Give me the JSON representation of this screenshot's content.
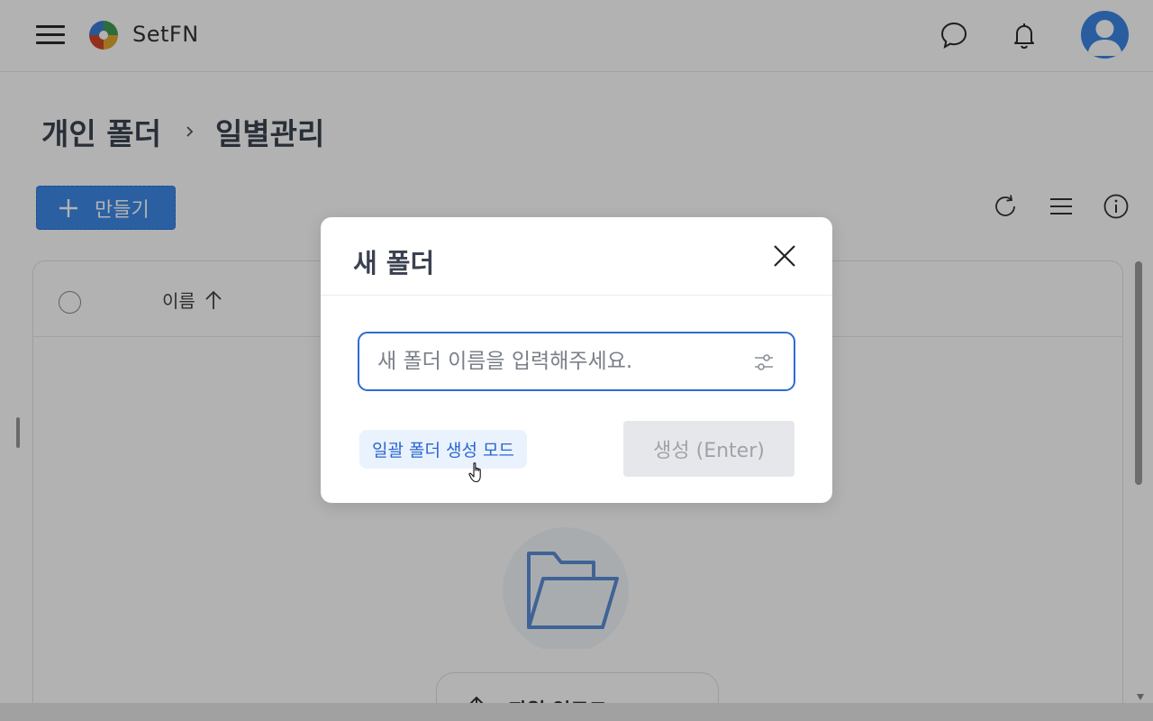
{
  "app": {
    "brand": "SetFN"
  },
  "breadcrumb": {
    "items": [
      "개인 폴더",
      "일별관리"
    ]
  },
  "toolbar": {
    "create_label": "만들기"
  },
  "table": {
    "name_column": "이름"
  },
  "upload": {
    "label": "파일 업로드"
  },
  "modal": {
    "title": "새 폴더",
    "input_placeholder": "새 폴더 이름을 입력해주세요.",
    "input_value": "",
    "bulk_mode_label": "일괄 폴더 생성 모드",
    "submit_label": "생성 (Enter)"
  },
  "icons": {
    "menu": "hamburger-icon",
    "logo": "setfn-logo-icon",
    "chat": "chat-bubble-icon",
    "notifications": "bell-icon",
    "user": "user-avatar-icon",
    "refresh": "refresh-icon",
    "list_view": "list-view-icon",
    "info": "info-icon",
    "sort": "arrow-up-icon",
    "close": "close-icon",
    "options": "sliders-icon",
    "folder": "open-folder-icon",
    "upload": "upload-arrow-icon"
  },
  "colors": {
    "accent": "#2f6ad6",
    "create_button": "#3d8ae8",
    "bulk_mode_bg": "#eaf2fd",
    "disabled_button": "#e6e7ea",
    "overlay": "rgba(0,0,0,0.30)"
  }
}
